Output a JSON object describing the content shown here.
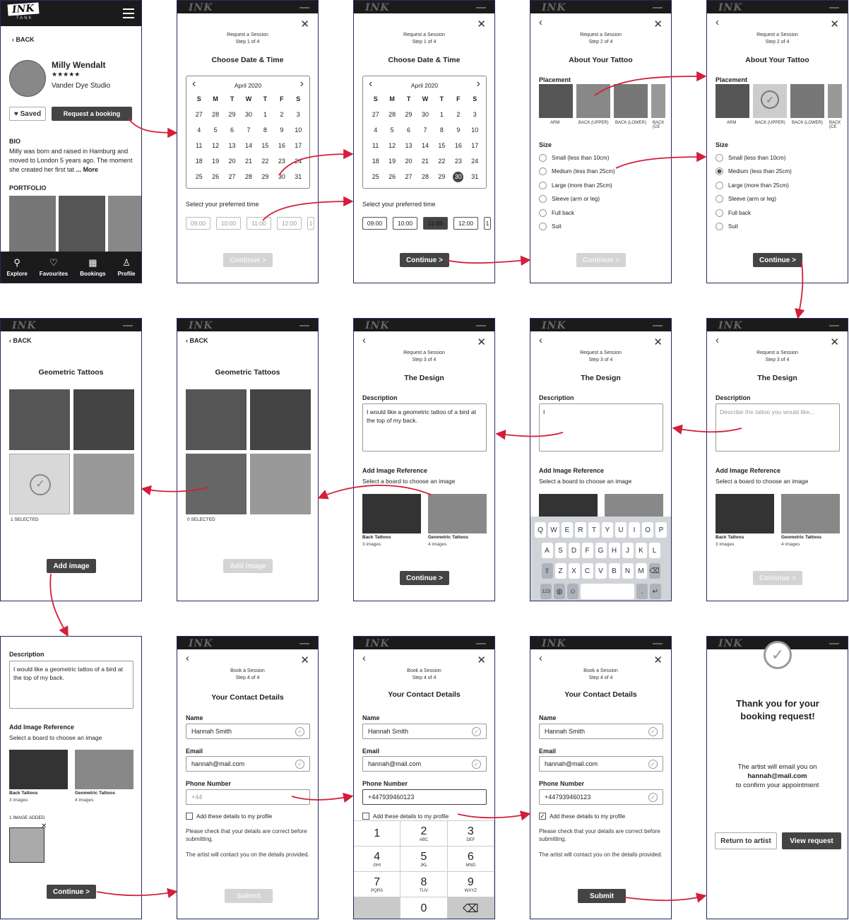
{
  "profile": {
    "logo": "INK",
    "logo_sub": "TANK",
    "back": "BACK",
    "name": "Milly Wendalt",
    "stars": "★★★★★",
    "studio": "Vander Dye Studio",
    "saved": "Saved",
    "request": "Request a booking",
    "bio_label": "BIO",
    "bio_text": "Milly was born and raised in Hamburg and moved to London 5 years ago. The moment she created her first tat",
    "more": "... More",
    "portfolio": "PORTFOLIO",
    "nav": [
      "Explore",
      "Favourites",
      "Bookings",
      "Profile"
    ]
  },
  "date": {
    "request": "Request a Session",
    "step": "Step 1 of 4",
    "title": "Choose Date & Time",
    "month": "April 2020",
    "days": [
      "S",
      "M",
      "T",
      "W",
      "T",
      "F",
      "S"
    ],
    "cells": [
      "27",
      "28",
      "29",
      "30",
      "1",
      "2",
      "3",
      "4",
      "5",
      "6",
      "7",
      "8",
      "9",
      "10",
      "11",
      "12",
      "13",
      "14",
      "15",
      "16",
      "17",
      "18",
      "19",
      "20",
      "21",
      "22",
      "23",
      "24",
      "25",
      "26",
      "27",
      "28",
      "29",
      "30",
      "31"
    ],
    "time_label": "Select your preferred time",
    "times": [
      "09:00",
      "10:00",
      "11:00",
      "12:00",
      "1"
    ],
    "continue": "Continue >"
  },
  "tattoo": {
    "step": "Step 2 of 4",
    "title": "About Your Tattoo",
    "placement": "Placement",
    "places": [
      "ARM",
      "BACK (UPPER)",
      "BACK (LOWER)",
      "BACK (CE"
    ],
    "size": "Size",
    "sizes": [
      "Small (less than 10cm)",
      "Medium (less than 25cm)",
      "Large (more than 25cm)",
      "Sleeve (arm or leg)",
      "Full back",
      "Suit"
    ]
  },
  "design": {
    "step": "Step 3 of 4",
    "title": "The Design",
    "desc": "Description",
    "placeholder": "Describe the tattoo you would like...",
    "desc_value": "I would like a geometric tattoo of a bird at the top of my back.",
    "ref": "Add Image Reference",
    "ref_sub": "Select a board to choose an image",
    "board1": "Back Tattoos",
    "board1_sub": "3 images",
    "board2": "Geometric Tattoos",
    "board2_sub": "4 images",
    "kb": [
      [
        "Q",
        "W",
        "E",
        "R",
        "T",
        "Y",
        "U",
        "I",
        "O",
        "P"
      ],
      [
        "A",
        "S",
        "D",
        "F",
        "G",
        "H",
        "J",
        "K",
        "L"
      ],
      [
        "Z",
        "X",
        "C",
        "V",
        "B",
        "N",
        "M"
      ]
    ],
    "kb_num": "123"
  },
  "geo": {
    "title": "Geometric Tattoos",
    "selected0": "0 SELECTED",
    "selected1": "1 SELECTED",
    "add": "Add image",
    "added": "1 IMAGE ADDED"
  },
  "contact": {
    "request": "Book a Session",
    "step": "Step 4 of 4",
    "title": "Your Contact Details",
    "name_lbl": "Name",
    "name": "Hannah Smith",
    "email_lbl": "Email",
    "email": "hannah@mail.com",
    "phone_lbl": "Phone Number",
    "phone_ph": "+44",
    "phone": "+447939460123",
    "save": "Add these details to my profile",
    "check": "Please check that your details are correct before submitting.",
    "contact_note": "The artist will contact you on the details provided.",
    "submit": "Submit",
    "keys": [
      [
        "1",
        ""
      ],
      [
        "2",
        "ABC"
      ],
      [
        "3",
        "DEF"
      ],
      [
        "4",
        "GHI"
      ],
      [
        "5",
        "JKL"
      ],
      [
        "6",
        "MNO"
      ],
      [
        "7",
        "PQRS"
      ],
      [
        "8",
        "TUV"
      ],
      [
        "9",
        "WXYZ"
      ]
    ]
  },
  "thanks": {
    "title": "Thank you for your booking request!",
    "line1": "The artist will email you on",
    "email": "hannah@mail.com",
    "line2": "to confirm your appointment",
    "return": "Return to artist",
    "view": "View request"
  },
  "colors": {
    "arrow": "#d31e3c",
    "dark": "#444444"
  }
}
